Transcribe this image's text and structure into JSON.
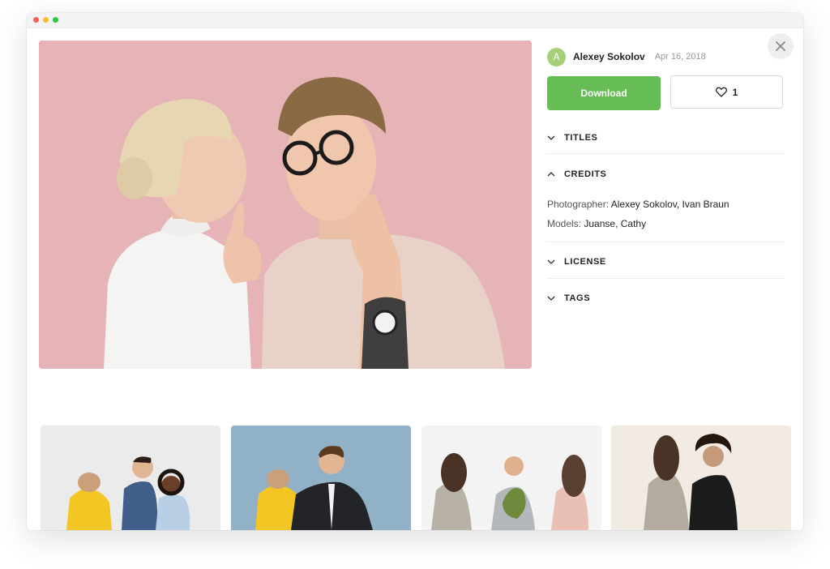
{
  "photo": {
    "author_initial": "A",
    "author_name": "Alexey Sokolov",
    "date": "Apr 16, 2018"
  },
  "actions": {
    "download_label": "Download",
    "like_count": "1"
  },
  "sections": {
    "titles": "TITLES",
    "credits": "CREDITS",
    "license": "LICENSE",
    "tags": "TAGS"
  },
  "credits": {
    "photographer_label": "Photographer:",
    "photographer": "Alexey Sokolov, Ivan Braun",
    "models_label": "Models:",
    "models": "Juanse, Cathy"
  },
  "icons": {
    "close": "close-icon",
    "like": "heart-icon",
    "section_collapsed": "chevron-down-icon",
    "section_expanded": "chevron-up-icon"
  },
  "colors": {
    "accent_green": "#67bd55",
    "avatar_green": "#a3cf77",
    "hero_background": "#e6b3b6"
  }
}
